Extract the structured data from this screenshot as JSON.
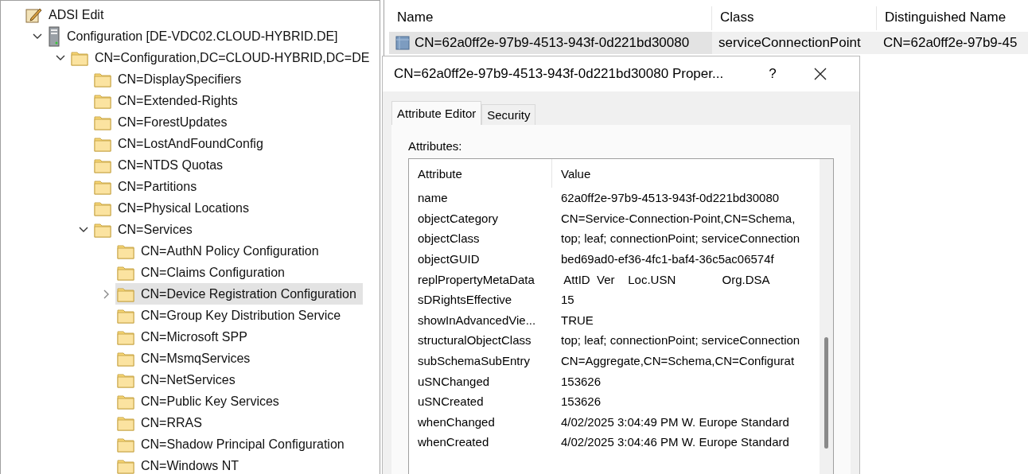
{
  "tree": {
    "label": "ADSI Edit",
    "kind": "app",
    "selected": false,
    "children": [
      {
        "label": "Configuration [DE-VDC02.CLOUD-HYBRID.DE]",
        "kind": "server",
        "expanded": true,
        "selected": false,
        "children": [
          {
            "label": "CN=Configuration,DC=CLOUD-HYBRID,DC=DE",
            "kind": "folder",
            "expanded": true,
            "selected": false,
            "children": [
              {
                "label": "CN=DisplaySpecifiers",
                "kind": "folder",
                "selected": false
              },
              {
                "label": "CN=Extended-Rights",
                "kind": "folder",
                "selected": false
              },
              {
                "label": "CN=ForestUpdates",
                "kind": "folder",
                "selected": false
              },
              {
                "label": "CN=LostAndFoundConfig",
                "kind": "folder",
                "selected": false
              },
              {
                "label": "CN=NTDS Quotas",
                "kind": "folder",
                "selected": false
              },
              {
                "label": "CN=Partitions",
                "kind": "folder",
                "selected": false
              },
              {
                "label": "CN=Physical Locations",
                "kind": "folder",
                "selected": false
              },
              {
                "label": "CN=Services",
                "kind": "folder",
                "expanded": true,
                "selected": false,
                "children": [
                  {
                    "label": "CN=AuthN Policy Configuration",
                    "kind": "folder",
                    "selected": false
                  },
                  {
                    "label": "CN=Claims Configuration",
                    "kind": "folder",
                    "selected": false
                  },
                  {
                    "label": "CN=Device Registration Configuration",
                    "kind": "folder",
                    "expanded": false,
                    "selected": true
                  },
                  {
                    "label": "CN=Group Key Distribution Service",
                    "kind": "folder",
                    "selected": false
                  },
                  {
                    "label": "CN=Microsoft SPP",
                    "kind": "folder",
                    "selected": false
                  },
                  {
                    "label": "CN=MsmqServices",
                    "kind": "folder",
                    "selected": false
                  },
                  {
                    "label": "CN=NetServices",
                    "kind": "folder",
                    "selected": false
                  },
                  {
                    "label": "CN=Public Key Services",
                    "kind": "folder",
                    "selected": false
                  },
                  {
                    "label": "CN=RRAS",
                    "kind": "folder",
                    "selected": false
                  },
                  {
                    "label": "CN=Shadow Principal Configuration",
                    "kind": "folder",
                    "selected": false
                  },
                  {
                    "label": "CN=Windows NT",
                    "kind": "folder",
                    "selected": false
                  }
                ]
              }
            ]
          }
        ]
      }
    ]
  },
  "list": {
    "columns": [
      "Name",
      "Class",
      "Distinguished Name"
    ],
    "rows": [
      {
        "cells": [
          "CN=62a0ff2e-97b9-4513-943f-0d221bd30080",
          "serviceConnectionPoint",
          "CN=62a0ff2e-97b9-45"
        ],
        "selected": true
      }
    ]
  },
  "dialog": {
    "title": "CN=62a0ff2e-97b9-4513-943f-0d221bd30080 Proper...",
    "help": "?",
    "tabs": [
      {
        "label": "Attribute Editor",
        "selected": true
      },
      {
        "label": "Security",
        "selected": false
      }
    ],
    "attributes_label": "Attributes:",
    "columns": [
      "Attribute",
      "Value"
    ],
    "rows": [
      {
        "attribute": "name",
        "value": "62a0ff2e-97b9-4513-943f-0d221bd30080"
      },
      {
        "attribute": "objectCategory",
        "value": "CN=Service-Connection-Point,CN=Schema,"
      },
      {
        "attribute": "objectClass",
        "value": "top; leaf; connectionPoint; serviceConnection"
      },
      {
        "attribute": "objectGUID",
        "value": "bed69ad0-ef36-4fc1-baf4-36c5ac06574f"
      },
      {
        "attribute": "replPropertyMetaData",
        "value": " AttID  Ver    Loc.USN              Org.DSA"
      },
      {
        "attribute": "sDRightsEffective",
        "value": "15"
      },
      {
        "attribute": "showInAdvancedVie...",
        "value": "TRUE"
      },
      {
        "attribute": "structuralObjectClass",
        "value": "top; leaf; connectionPoint; serviceConnection"
      },
      {
        "attribute": "subSchemaSubEntry",
        "value": "CN=Aggregate,CN=Schema,CN=Configurat"
      },
      {
        "attribute": "uSNChanged",
        "value": "153626"
      },
      {
        "attribute": "uSNCreated",
        "value": "153626"
      },
      {
        "attribute": "whenChanged",
        "value": "4/02/2025 3:04:49 PM W. Europe Standard"
      },
      {
        "attribute": "whenCreated",
        "value": "4/02/2025 3:04:46 PM W. Europe Standard"
      }
    ]
  }
}
